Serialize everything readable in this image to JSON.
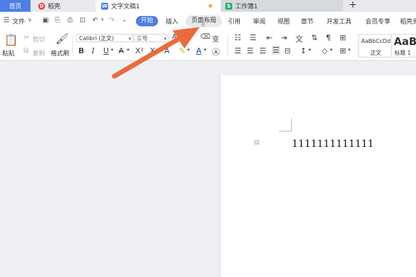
{
  "tabs": {
    "home": "首页",
    "straw": "稻壳",
    "doc": "文字文稿1",
    "sheet": "工作簿1",
    "new_tab": "+"
  },
  "menu": {
    "file": "文件",
    "start": "开始",
    "insert": "插入",
    "layout": "页面布局",
    "reference": "引用",
    "review": "审阅",
    "view": "视图",
    "chapter": "章节",
    "dev_tools": "开发工具",
    "member": "会员专享",
    "more": "稻壳资"
  },
  "toolbar": {
    "paste": "粘贴",
    "cut": "剪切",
    "copy": "复制",
    "format_painter": "格式刷",
    "font_name": "Calibri (正文)",
    "font_size": "三号",
    "style_normal_sample": "AaBbCcDd",
    "style_normal_label": "正文",
    "style_heading_sample": "AaBb",
    "style_heading_label": "标题 1"
  },
  "document": {
    "text": "1111111111111"
  },
  "colors": {
    "accent": "#4d7ee8",
    "arrow": "#ec6a3c",
    "straw_icon": "#e8483a",
    "doc_icon": "#4d7ee8",
    "sheet_icon": "#2bb36b"
  }
}
